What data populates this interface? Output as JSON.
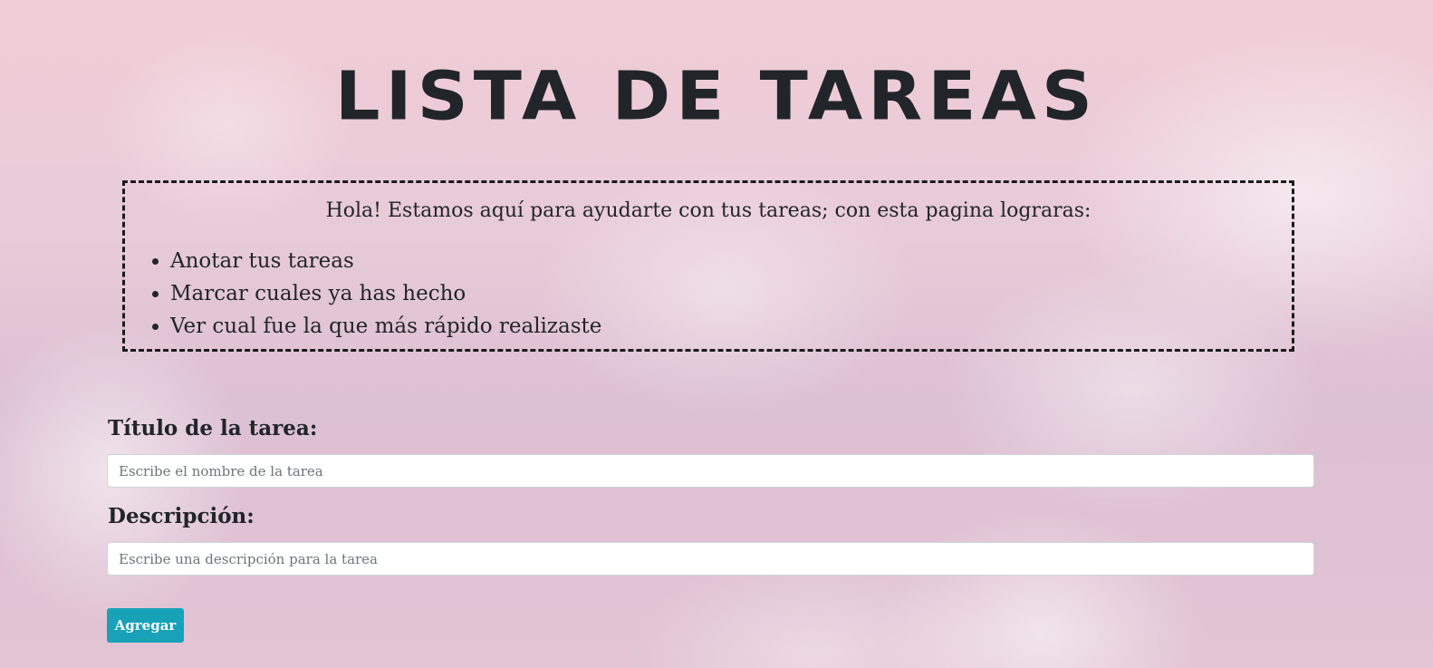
{
  "header": {
    "title": "LISTA DE TAREAS"
  },
  "info": {
    "intro": "Hola! Estamos aquí para ayudarte con tus tareas; con esta pagina lograras:",
    "items": [
      "Anotar tus tareas",
      "Marcar cuales ya has hecho",
      "Ver cual fue la que más rápido realizaste"
    ]
  },
  "form": {
    "title_label": "Título de la tarea:",
    "title_placeholder": "Escribe el nombre de la tarea",
    "description_label": "Descripción:",
    "description_placeholder": "Escribe una descripción para la tarea",
    "add_button_label": "Agregar"
  },
  "colors": {
    "text": "#212529",
    "button": "#17a2b8",
    "button_text": "#ffffff",
    "input_bg": "#ffffff"
  }
}
